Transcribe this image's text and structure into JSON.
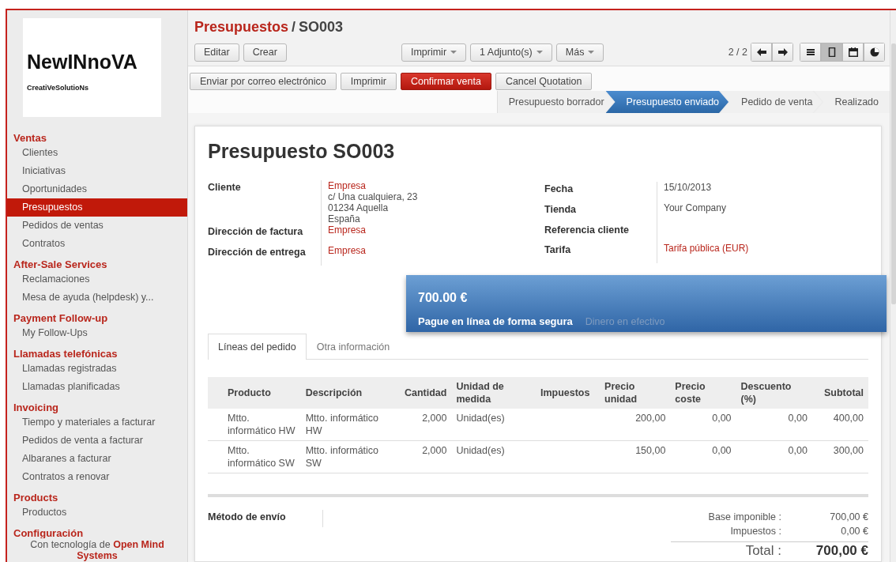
{
  "logo": {
    "title": "NewINnoVA",
    "subtitle": "CreatiVeSolutioNs"
  },
  "sidebar": {
    "sections": [
      {
        "title": "Ventas",
        "items": [
          {
            "label": "Clientes",
            "selected": false
          },
          {
            "label": "Iniciativas",
            "selected": false
          },
          {
            "label": "Oportunidades",
            "selected": false
          },
          {
            "label": "Presupuestos",
            "selected": true
          },
          {
            "label": "Pedidos de ventas",
            "selected": false
          },
          {
            "label": "Contratos",
            "selected": false
          }
        ]
      },
      {
        "title": "After-Sale Services",
        "items": [
          {
            "label": "Reclamaciones",
            "selected": false
          },
          {
            "label": "Mesa de ayuda (helpdesk) y...",
            "selected": false
          }
        ]
      },
      {
        "title": "Payment Follow-up",
        "items": [
          {
            "label": "My Follow-Ups",
            "selected": false
          }
        ]
      },
      {
        "title": "Llamadas telefónicas",
        "items": [
          {
            "label": "Llamadas registradas",
            "selected": false
          },
          {
            "label": "Llamadas planificadas",
            "selected": false
          }
        ]
      },
      {
        "title": "Invoicing",
        "items": [
          {
            "label": "Tiempo y materiales a facturar",
            "selected": false
          },
          {
            "label": "Pedidos de venta a facturar",
            "selected": false
          },
          {
            "label": "Albaranes a facturar",
            "selected": false
          },
          {
            "label": "Contratos a renovar",
            "selected": false
          }
        ]
      },
      {
        "title": "Products",
        "items": [
          {
            "label": "Productos",
            "selected": false
          }
        ]
      },
      {
        "title": "Configuración"
      }
    ],
    "footer": {
      "text": "Con tecnología de",
      "brand": "Open Mind Systems"
    }
  },
  "breadcrumb": {
    "parent": "Presupuestos",
    "separator": "/",
    "current": "SO003"
  },
  "toolbar": {
    "buttons": [
      "Editar",
      "Crear"
    ],
    "dropdowns": [
      "Imprimir",
      "1 Adjunto(s)",
      "Más"
    ],
    "pager": "2 / 2",
    "views": [
      {
        "kind": "list",
        "selected": false
      },
      {
        "kind": "form",
        "selected": true
      },
      {
        "kind": "calendar",
        "selected": false
      },
      {
        "kind": "graph",
        "selected": false
      }
    ]
  },
  "actions": [
    {
      "label": "Enviar por correo electrónico",
      "kind": "default"
    },
    {
      "label": "Imprimir",
      "kind": "default"
    },
    {
      "label": "Confirmar venta",
      "kind": "primary"
    },
    {
      "label": "Cancel Quotation",
      "kind": "default"
    }
  ],
  "stages": [
    {
      "label": "Presupuesto borrador",
      "selected": false
    },
    {
      "label": "Presupuesto enviado",
      "selected": true
    },
    {
      "label": "Pedido de venta",
      "selected": false
    },
    {
      "label": "Realizado",
      "selected": false
    }
  ],
  "form": {
    "title": "Presupuesto SO003",
    "left_fields": [
      {
        "label": "Cliente",
        "lines": [
          {
            "text": "Empresa",
            "kind": "link"
          },
          {
            "text": "c/ Una cualquiera, 23",
            "kind": "plain"
          },
          {
            "text": "01234 Aquella",
            "kind": "plain"
          },
          {
            "text": "España",
            "kind": "plain"
          }
        ]
      },
      {
        "label": "Dirección de factura",
        "lines": [
          {
            "text": "Empresa",
            "kind": "link"
          }
        ]
      },
      {
        "label": "Dirección de entrega",
        "lines": [
          {
            "text": "Empresa",
            "kind": "link"
          }
        ]
      }
    ],
    "right_fields": [
      {
        "label": "Fecha",
        "lines": [
          {
            "text": "15/10/2013",
            "kind": "plain"
          }
        ]
      },
      {
        "label": "Tienda",
        "lines": [
          {
            "text": "Your Company",
            "kind": "plain"
          }
        ]
      },
      {
        "label": "Referencia cliente"
      },
      {
        "label": "Tarifa",
        "lines": [
          {
            "text": "Tarifa pública (EUR)",
            "kind": "link"
          }
        ]
      }
    ],
    "tabs": [
      {
        "label": "Líneas del pedido",
        "selected": true
      },
      {
        "label": "Otra información",
        "selected": false
      }
    ],
    "table": {
      "columns": [
        "Producto",
        "Descripción",
        "Cantidad",
        "Unidad de medida",
        "Impuestos",
        "Precio unidad",
        "Precio coste",
        "Descuento (%)",
        "Subtotal"
      ],
      "rows": [
        [
          "Mtto. informático HW",
          "Mtto. informático HW",
          "2,000",
          "Unidad(es)",
          "",
          "200,00",
          "0,00",
          "0,00",
          "400,00"
        ],
        [
          "Mtto. informático SW",
          "Mtto. informático SW",
          "2,000",
          "Unidad(es)",
          "",
          "150,00",
          "0,00",
          "0,00",
          "300,00"
        ]
      ]
    },
    "shipping_label": "Método de envío",
    "totals": [
      {
        "label": "Base imponible :",
        "value": "700,00 €"
      },
      {
        "label": "Impuestos :",
        "value": "0,00 €"
      }
    ],
    "grand_total": {
      "label": "Total :",
      "value": "700,00 €"
    }
  },
  "payment": {
    "amount": "700.00 €",
    "label": "Pague en línea de forma segura",
    "method": "Dinero en efectivo"
  }
}
